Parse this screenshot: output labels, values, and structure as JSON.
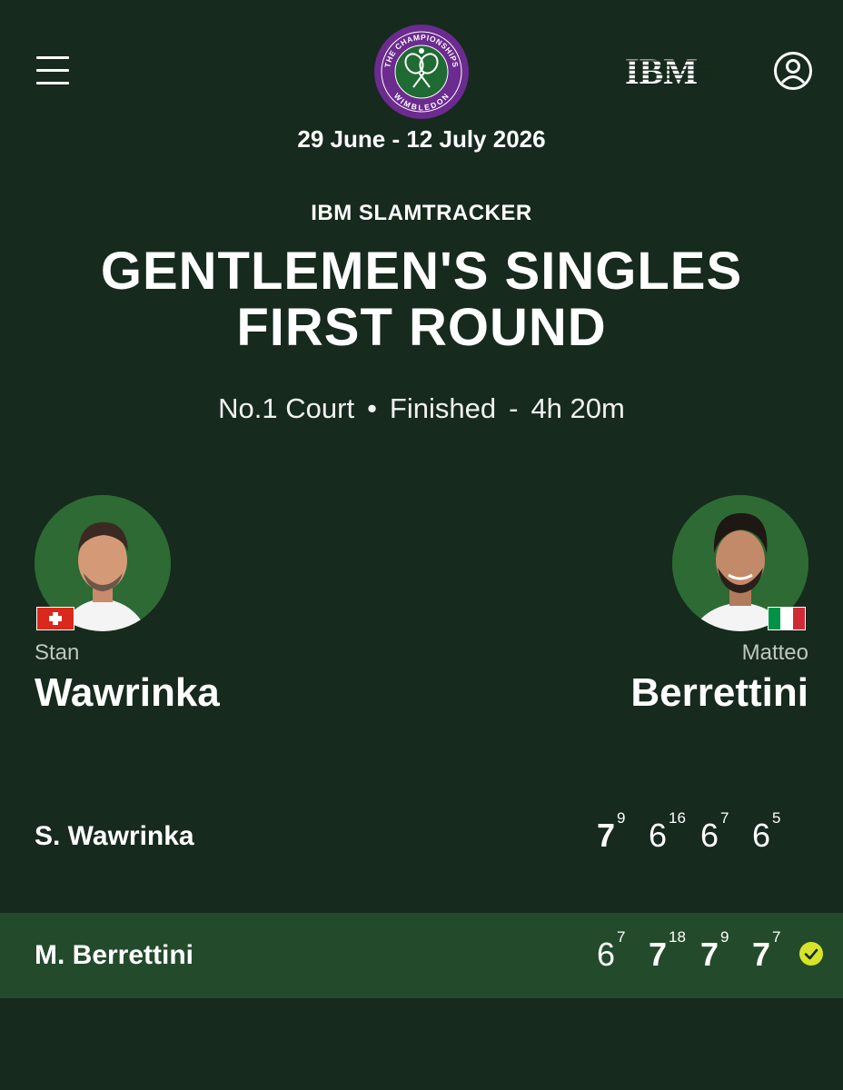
{
  "header": {
    "logo": {
      "top_text": "THE CHAMPIONSHIPS",
      "bottom_text": "WIMBLEDON",
      "ring_color": "#6b2b8f",
      "center_color": "#1f6b33"
    },
    "sponsor_logo": "IBM",
    "dates": "29 June - 12 July 2026"
  },
  "tracker": {
    "label": "IBM SLAMTRACKER",
    "title_line1": "GENTLEMEN'S SINGLES",
    "title_line2": "FIRST ROUND",
    "court": "No.1 Court",
    "bullet": "•",
    "status": "Finished",
    "dash": "-",
    "duration": "4h 20m"
  },
  "players": {
    "p1": {
      "first_name": "Stan",
      "last_name": "Wawrinka",
      "flag": "flag-switzerland"
    },
    "p2": {
      "first_name": "Matteo",
      "last_name": "Berrettini",
      "flag": "flag-italy"
    }
  },
  "scoreboard": {
    "rows": [
      {
        "name": "S. Wawrinka",
        "sets": [
          {
            "games": "7",
            "tiebreak": "9",
            "won": true
          },
          {
            "games": "6",
            "tiebreak": "16",
            "won": false
          },
          {
            "games": "6",
            "tiebreak": "7",
            "won": false
          },
          {
            "games": "6",
            "tiebreak": "5",
            "won": false
          }
        ],
        "winner": false
      },
      {
        "name": "M. Berrettini",
        "sets": [
          {
            "games": "6",
            "tiebreak": "7",
            "won": false
          },
          {
            "games": "7",
            "tiebreak": "18",
            "won": true
          },
          {
            "games": "7",
            "tiebreak": "9",
            "won": true
          },
          {
            "games": "7",
            "tiebreak": "7",
            "won": true
          }
        ],
        "winner": true
      }
    ]
  },
  "colors": {
    "background": "#162a1d",
    "winner_row": "#234b2b",
    "winner_check": "#d6e32a",
    "photo_background": "#2d6a34"
  }
}
